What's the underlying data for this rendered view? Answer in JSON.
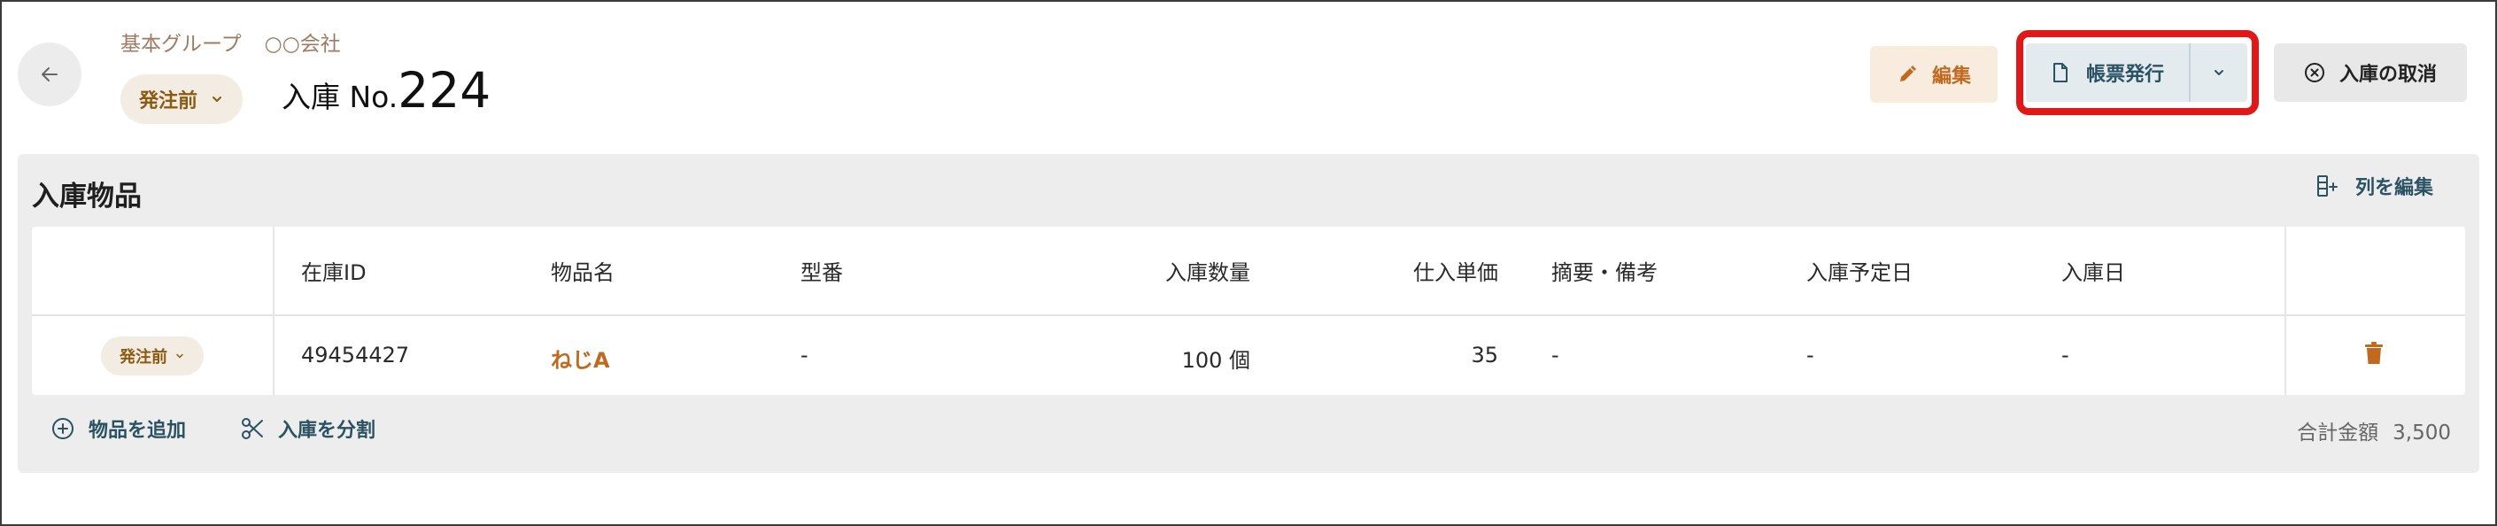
{
  "header": {
    "breadcrumb": [
      "基本グループ",
      "○○会社"
    ],
    "status_label": "発注前",
    "title_prefix": "入庫 No.",
    "title_number": "224"
  },
  "toolbar": {
    "edit_label": "編集",
    "report_label": "帳票発行",
    "cancel_label": "入庫の取消"
  },
  "panel": {
    "title": "入庫物品",
    "edit_columns_label": "列を編集"
  },
  "table": {
    "columns": [
      "在庫ID",
      "物品名",
      "型番",
      "入庫数量",
      "仕入単価",
      "摘要・備考",
      "入庫予定日",
      "入庫日"
    ],
    "rows": [
      {
        "status": "発注前",
        "stock_id": "49454427",
        "item_name": "ねじA",
        "model": "-",
        "quantity": "100 個",
        "unit_price": "35",
        "note": "-",
        "planned_date": "-",
        "received_date": "-"
      }
    ]
  },
  "footer": {
    "add_item_label": "物品を追加",
    "split_label": "入庫を分割",
    "total_label": "合計金額",
    "total_value": "3,500"
  },
  "colors": {
    "accent_orange": "#c06a20",
    "accent_teal": "#2a5263",
    "status_brown": "#8d5a12",
    "highlight_red": "#e01818",
    "delete_icon": "#c06a20"
  },
  "icons": {
    "back": "arrow-left-icon",
    "status_dropdown": "chevron-down-icon",
    "edit": "pencil-icon",
    "report": "document-icon",
    "report_dropdown": "chevron-down-icon",
    "cancel": "circle-x-icon",
    "edit_columns": "columns-plus-icon",
    "delete": "trash-icon",
    "add_item": "circle-plus-icon",
    "split": "scissors-icon"
  }
}
